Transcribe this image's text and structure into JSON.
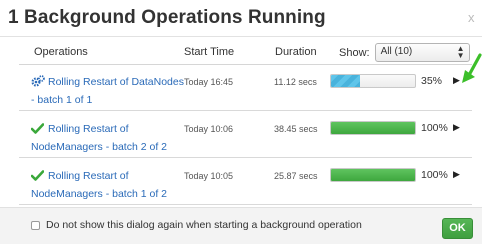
{
  "dialog": {
    "title": "1 Background Operations Running",
    "close_label": "x"
  },
  "columns": {
    "operations": "Operations",
    "start_time": "Start Time",
    "duration": "Duration",
    "show_label": "Show:"
  },
  "filter": {
    "selected": "All (10)",
    "arrows": "▲\n▼"
  },
  "operations": [
    {
      "icon": "gears-icon",
      "name": "Rolling Restart of DataNodes - batch 1 of 1",
      "start_time": "Today 16:45",
      "duration": "11.12 secs",
      "progress": 35,
      "percent_label": "35%",
      "status": "running",
      "color": "#5fc5ea"
    },
    {
      "icon": "checkmark-icon",
      "name": "Rolling Restart of NodeManagers - batch 2 of 2",
      "start_time": "Today 10:06",
      "duration": "38.45 secs",
      "progress": 100,
      "percent_label": "100%",
      "status": "completed",
      "color": "#4cb84c"
    },
    {
      "icon": "checkmark-icon",
      "name": "Rolling Restart of NodeManagers - batch 1 of 2",
      "start_time": "Today 10:05",
      "duration": "25.87 secs",
      "progress": 100,
      "percent_label": "100%",
      "status": "completed",
      "color": "#4cb84c"
    }
  ],
  "footer": {
    "checkbox_label": "Do not show this dialog again when starting a background operation",
    "checkbox_checked": false,
    "ok_label": "OK"
  },
  "annotation": {
    "arrow_color": "#3cbf2a"
  }
}
